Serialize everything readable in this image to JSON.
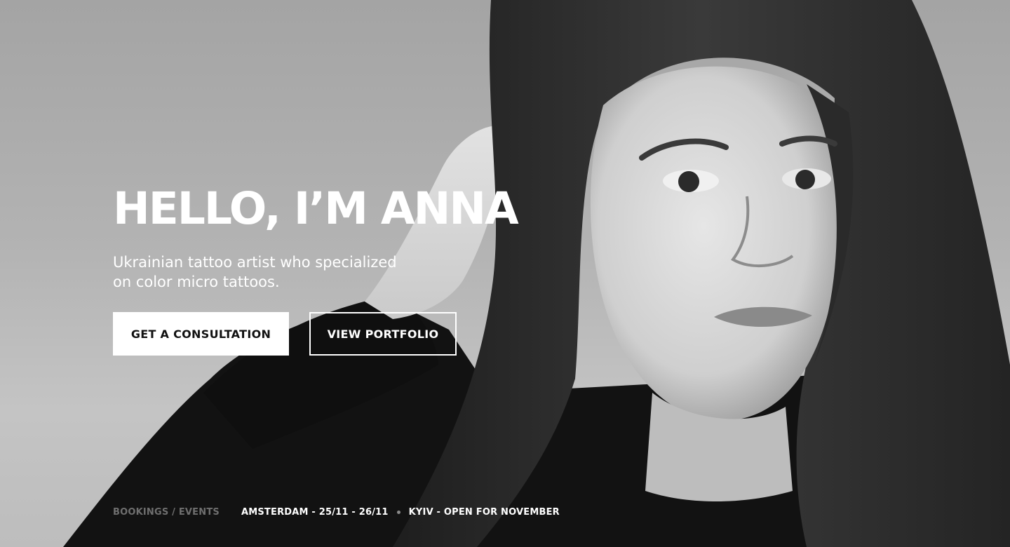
{
  "hero": {
    "title": "HELLO, I’M ANNA",
    "subtitle": "Ukrainian tattoo artist who specialized on color micro tattoos.",
    "primary_button": "GET A CONSULTATION",
    "secondary_button": "VIEW PORTFOLIO"
  },
  "events": {
    "label": "BOOKINGS / EVENTS",
    "items": [
      "AMSTERDAM - 25/11 - 26/11",
      "KYIV - OPEN FOR NOVEMBER"
    ]
  },
  "colors": {
    "text": "#ffffff",
    "primary_button_bg": "#ffffff",
    "primary_button_text": "#111111",
    "muted_label": "#6f6f6f"
  }
}
